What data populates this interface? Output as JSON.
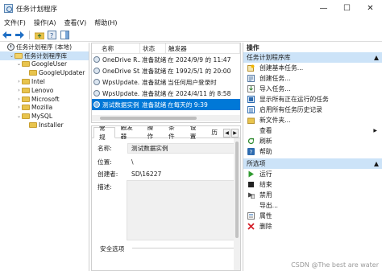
{
  "window": {
    "title": "任务计划程序",
    "minimize": "—",
    "maximize": "☐",
    "close": "✕"
  },
  "menu": [
    "文件(F)",
    "操作(A)",
    "查看(V)",
    "帮助(H)"
  ],
  "tree": {
    "items": [
      {
        "label": "任务计划程序 (本地)",
        "level": 0,
        "toggle": "",
        "icon": "clock"
      },
      {
        "label": "任务计划程序库",
        "level": 1,
        "toggle": "⌄",
        "icon": "folder-open",
        "selected": true
      },
      {
        "label": "GoogleUser",
        "level": 2,
        "toggle": "⌄",
        "icon": "folder"
      },
      {
        "label": "GoogleUpdater",
        "level": 3,
        "toggle": "",
        "icon": "folder"
      },
      {
        "label": "Intel",
        "level": 2,
        "toggle": "›",
        "icon": "folder"
      },
      {
        "label": "Lenovo",
        "level": 2,
        "toggle": "›",
        "icon": "folder"
      },
      {
        "label": "Microsoft",
        "level": 2,
        "toggle": "›",
        "icon": "folder"
      },
      {
        "label": "Mozilla",
        "level": 2,
        "toggle": "›",
        "icon": "folder"
      },
      {
        "label": "MySQL",
        "level": 2,
        "toggle": "⌄",
        "icon": "folder"
      },
      {
        "label": "Installer",
        "level": 3,
        "toggle": "",
        "icon": "folder"
      }
    ]
  },
  "tasklist": {
    "headers": [
      "名称",
      "状态",
      "触发器"
    ],
    "rows": [
      {
        "name": "OneDrive R...",
        "status": "准备就绪",
        "trigger": "在 2024/9/9 的 11:47",
        "selected": false
      },
      {
        "name": "OneDrive St...",
        "status": "准备就绪",
        "trigger": "在 1992/5/1 的 20:00",
        "selected": false
      },
      {
        "name": "WpsUpdate...",
        "status": "准备就绪",
        "trigger": "当任何用户登录时",
        "selected": false
      },
      {
        "name": "WpsUpdate...",
        "status": "准备就绪",
        "trigger": "在 2024/4/11 的 8:58",
        "selected": false
      },
      {
        "name": "测试数据实例",
        "status": "准备就绪",
        "trigger": "在每天的 9:39",
        "selected": true
      }
    ]
  },
  "detail": {
    "tabs": [
      "常规",
      "触发器",
      "操作",
      "条件",
      "设置",
      "历"
    ],
    "fields": {
      "name_label": "名称:",
      "name_value": "测试数据实例",
      "location_label": "位置:",
      "location_value": "\\",
      "author_label": "创建者:",
      "author_value": "SD\\16227",
      "desc_label": "描述:"
    },
    "security_label": "安全选项"
  },
  "actions": {
    "header": "操作",
    "section1_title": "任务计划程序库",
    "section1": [
      {
        "label": "创建基本任务...",
        "icon": "create-basic-task-icon"
      },
      {
        "label": "创建任务...",
        "icon": "create-task-icon"
      },
      {
        "label": "导入任务...",
        "icon": "import-icon"
      },
      {
        "label": "显示所有正在运行的任务",
        "icon": "running-tasks-icon"
      },
      {
        "label": "启用所有任务历史记录",
        "icon": "history-icon"
      },
      {
        "label": "新文件夹...",
        "icon": "new-folder-icon"
      },
      {
        "label": "查看",
        "icon": "view-icon",
        "submenu": true
      },
      {
        "label": "刷新",
        "icon": "refresh-icon"
      },
      {
        "label": "帮助",
        "icon": "help-icon"
      }
    ],
    "section2_title": "所选项",
    "section2": [
      {
        "label": "运行",
        "icon": "run-icon"
      },
      {
        "label": "结束",
        "icon": "end-icon"
      },
      {
        "label": "禁用",
        "icon": "disable-icon"
      },
      {
        "label": "导出...",
        "icon": "export-icon"
      },
      {
        "label": "属性",
        "icon": "properties-icon"
      },
      {
        "label": "删除",
        "icon": "delete-icon"
      }
    ]
  },
  "watermark": "CSDN @The best are water",
  "colors": {
    "selection": "#0078d7",
    "tree_selection": "#cce3f8"
  }
}
